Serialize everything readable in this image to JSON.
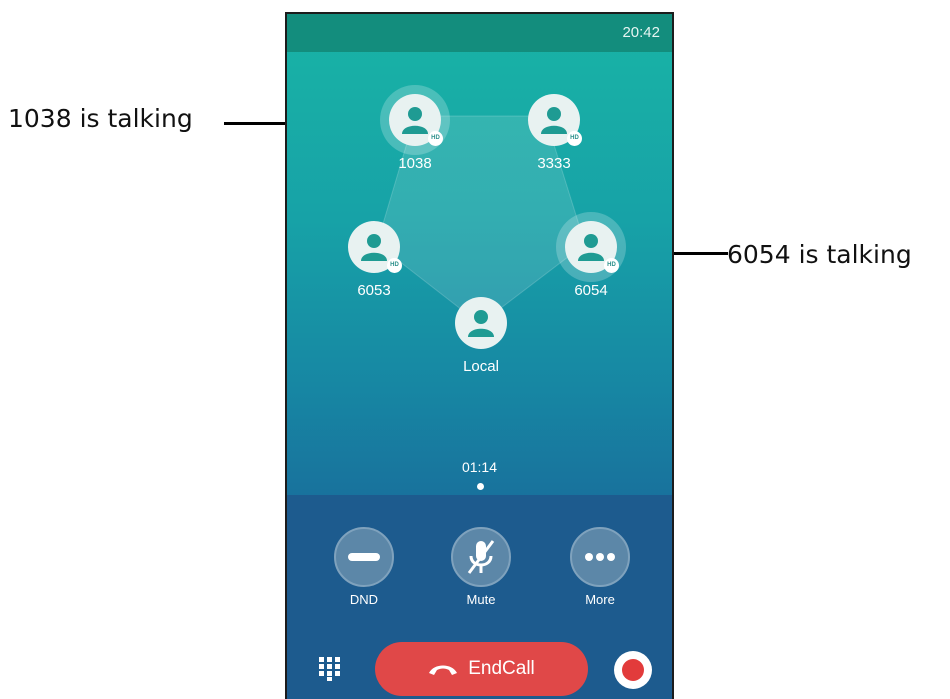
{
  "callouts": {
    "left": "1038 is talking",
    "right": "6054 is talking"
  },
  "status_bar": {
    "time": "20:42"
  },
  "participants": [
    {
      "name": "1038",
      "talking": true,
      "hd": "HD"
    },
    {
      "name": "3333",
      "talking": false,
      "hd": "HD"
    },
    {
      "name": "6053",
      "talking": false,
      "hd": "HD"
    },
    {
      "name": "6054",
      "talking": true,
      "hd": "HD"
    },
    {
      "name": "Local",
      "talking": false
    }
  ],
  "call": {
    "duration": "01:14"
  },
  "controls": {
    "dnd": "DND",
    "mute": "Mute",
    "more": "More",
    "endcall": "EndCall"
  },
  "colors": {
    "status_bar": "#138d7d",
    "controls_bg": "#1d5b8e",
    "endcall": "#e04848",
    "record": "#e23b3b"
  }
}
